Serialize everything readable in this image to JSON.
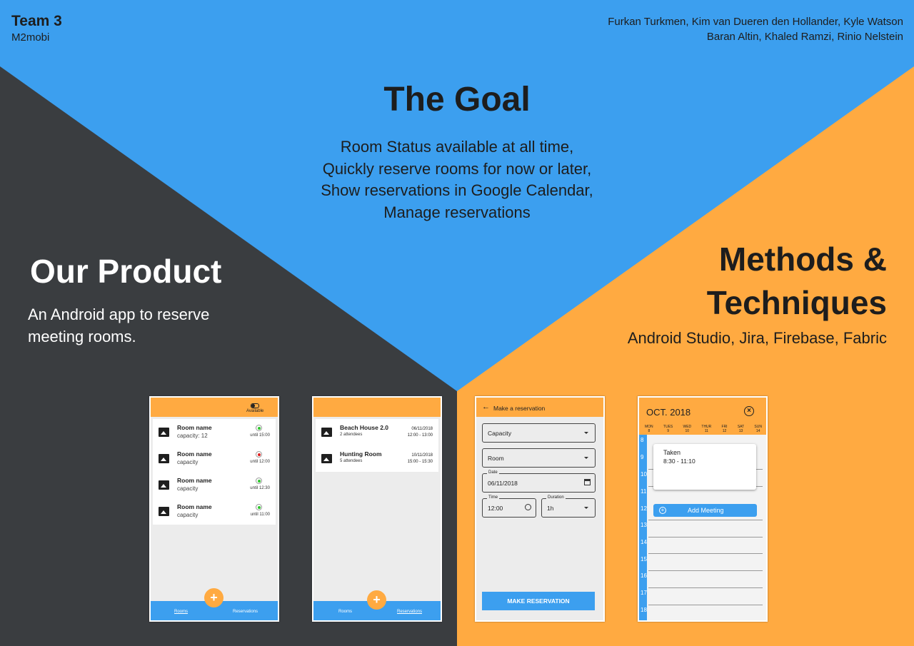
{
  "header": {
    "team": "Team 3",
    "org": "M2mobi",
    "authors_line1": "Furkan Turkmen, Kim van Dueren den Hollander, Kyle Watson",
    "authors_line2": "Baran Altin, Khaled Ramzi, Rinio Nelstein"
  },
  "goal": {
    "title": "The Goal",
    "lines": [
      "Room Status available at all time,",
      "Quickly reserve rooms for now or later,",
      "Show reservations in Google Calendar,",
      "Manage reservations"
    ]
  },
  "product": {
    "title": "Our Product",
    "description": "An Android app to reserve meeting rooms."
  },
  "methods": {
    "title_line1": "Methods &",
    "title_line2": "Techniques",
    "description": "Android Studio, Jira, Firebase, Fabric"
  },
  "colors": {
    "blue": "#3c9fef",
    "dark": "#3a3d40",
    "orange": "#ffaa41"
  },
  "phone1": {
    "available_label": "Available",
    "rooms": [
      {
        "name": "Room name",
        "capacity": "capacity: 12",
        "status": "green",
        "until": "until 15:00"
      },
      {
        "name": "Room name",
        "capacity": "capacity",
        "status": "red",
        "until": "until 12:00"
      },
      {
        "name": "Room name",
        "capacity": "capacity",
        "status": "green",
        "until": "until 12:30"
      },
      {
        "name": "Room name",
        "capacity": "capacity",
        "status": "green",
        "until": "until 11:00"
      }
    ],
    "fab": "+",
    "nav_rooms": "Rooms",
    "nav_reservations": "Reservations"
  },
  "phone2": {
    "reservations": [
      {
        "name": "Beach House 2.0",
        "attendees": "2 attendees",
        "date": "06/11/2018",
        "time": "12:00 - 13:00"
      },
      {
        "name": "Hunting Room",
        "attendees": "5 attendees",
        "date": "10/11/2018",
        "time": "15:00 - 15:30"
      }
    ],
    "fab": "+",
    "nav_rooms": "Rooms",
    "nav_reservations": "Reservations"
  },
  "phone3": {
    "back_icon": "←",
    "title": "Make a reservation",
    "capacity_placeholder": "Capacity",
    "room_placeholder": "Room",
    "date_label": "Date",
    "date_value": "06/11/2018",
    "time_label": "Time",
    "time_value": "12:00",
    "duration_label": "Duration",
    "duration_value": "1h",
    "button": "MAKE RESERVATION"
  },
  "phone4": {
    "month": "OCT. 2018",
    "close": "×",
    "days": [
      {
        "name": "MON",
        "num": "8"
      },
      {
        "name": "TUES",
        "num": "9"
      },
      {
        "name": "WED",
        "num": "10"
      },
      {
        "name": "THUR",
        "num": "11"
      },
      {
        "name": "FRI",
        "num": "12"
      },
      {
        "name": "SAT",
        "num": "13"
      },
      {
        "name": "SUN",
        "num": "14"
      }
    ],
    "hours": [
      "8",
      "9",
      "10",
      "11",
      "12",
      "13",
      "14",
      "15",
      "16",
      "17",
      "18"
    ],
    "taken_label": "Taken",
    "taken_time": "8:30 - 11:10",
    "add_meeting": "Add Meeting",
    "add_icon": "+"
  }
}
